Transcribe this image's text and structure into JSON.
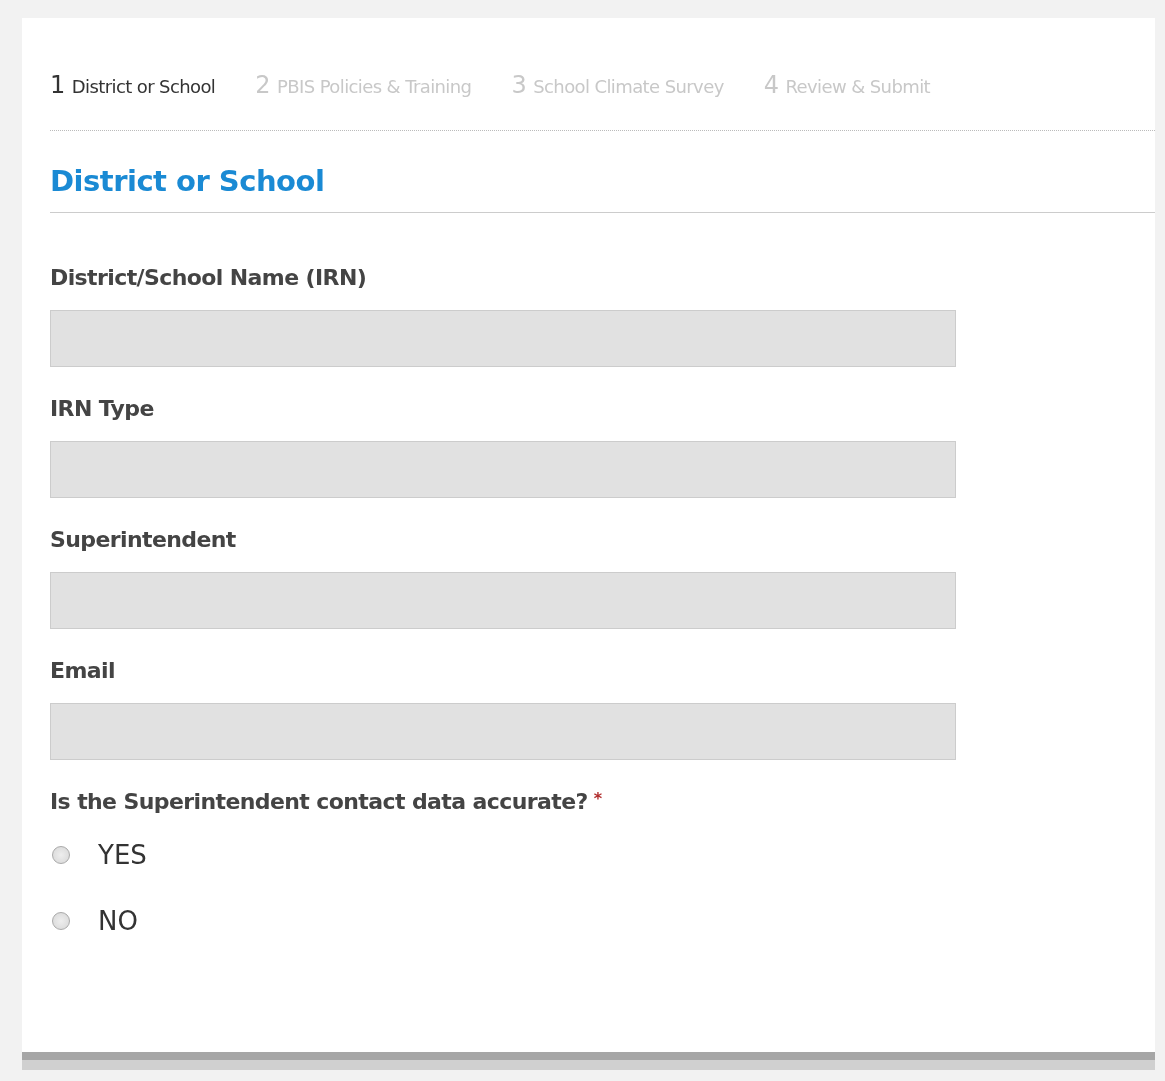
{
  "steps": [
    {
      "number": "1",
      "label": "District or School",
      "selected": true
    },
    {
      "number": "2",
      "label": "PBIS Policies & Training",
      "selected": false
    },
    {
      "number": "3",
      "label": "School Climate Survey",
      "selected": false
    },
    {
      "number": "4",
      "label": "Review & Submit",
      "selected": false
    }
  ],
  "section_title": "District or School",
  "fields": [
    {
      "label": "District/School Name (IRN)",
      "disabled": true
    },
    {
      "label": "IRN Type",
      "disabled": true
    },
    {
      "label": "Superintendent",
      "disabled": true
    },
    {
      "label": "Email",
      "disabled": true
    }
  ],
  "question": {
    "label": "Is the Superintendent contact data accurate?",
    "required": true,
    "required_mark": "*",
    "options": [
      {
        "label": "YES",
        "selected": false
      },
      {
        "label": "NO",
        "selected": false
      }
    ]
  }
}
